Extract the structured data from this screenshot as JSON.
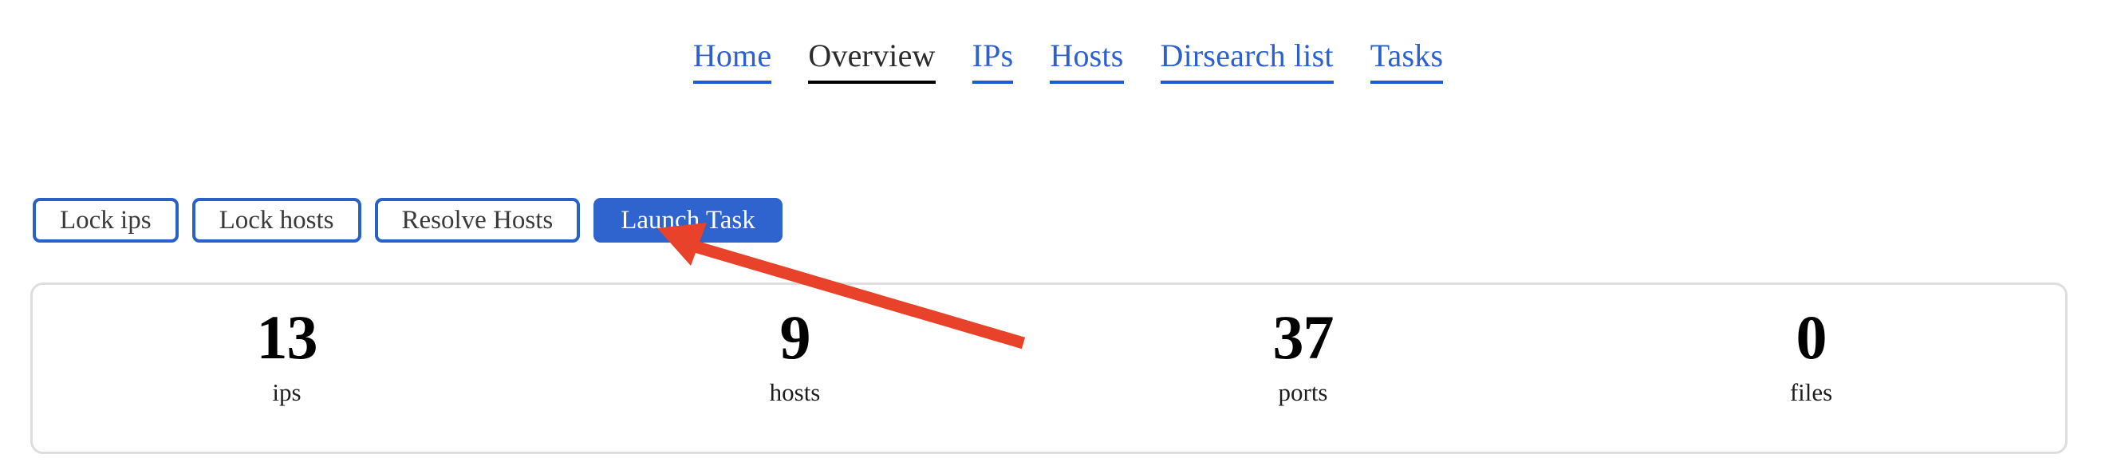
{
  "nav": {
    "items": [
      {
        "label": "Home",
        "active": false,
        "name": "nav-item-home"
      },
      {
        "label": "Overview",
        "active": true,
        "name": "nav-item-overview"
      },
      {
        "label": "IPs",
        "active": false,
        "name": "nav-item-ips"
      },
      {
        "label": "Hosts",
        "active": false,
        "name": "nav-item-hosts"
      },
      {
        "label": "Dirsearch list",
        "active": false,
        "name": "nav-item-dirsearch-list"
      },
      {
        "label": "Tasks",
        "active": false,
        "name": "nav-item-tasks"
      }
    ]
  },
  "toolbar": {
    "lock_ips_label": "Lock ips",
    "lock_hosts_label": "Lock hosts",
    "resolve_hosts_label": "Resolve Hosts",
    "launch_task_label": "Launch Task"
  },
  "stats": [
    {
      "value": "13",
      "label": "ips"
    },
    {
      "value": "9",
      "label": "hosts"
    },
    {
      "value": "37",
      "label": "ports"
    },
    {
      "value": "0",
      "label": "files"
    }
  ],
  "annotation": {
    "arrow_color": "#e8422a",
    "points_at": "Resolve Hosts"
  },
  "colors": {
    "link_blue": "#2c5fd0",
    "primary_blue": "#2f63cd",
    "active_underline": "#000000",
    "panel_border": "#dddedf",
    "arrow_red": "#e8422a"
  }
}
